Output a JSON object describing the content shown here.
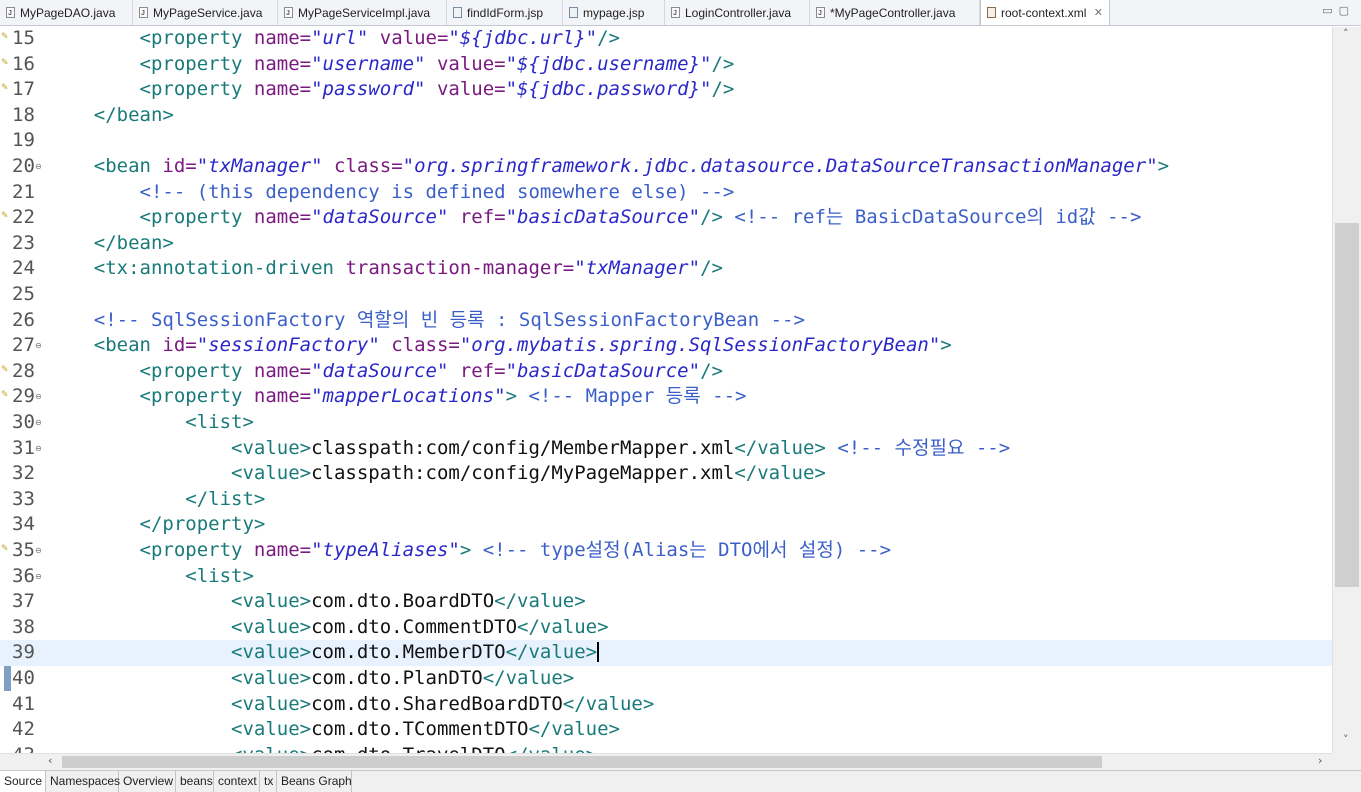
{
  "tabs": [
    {
      "label": "MyPageDAO.java",
      "icon": "java-file-icon",
      "kind": "java"
    },
    {
      "label": "MyPageService.java",
      "icon": "java-file-icon",
      "kind": "java"
    },
    {
      "label": "MyPageServiceImpl.java",
      "icon": "java-file-icon",
      "kind": "java"
    },
    {
      "label": "findIdForm.jsp",
      "icon": "jsp-file-icon",
      "kind": "jsp"
    },
    {
      "label": "mypage.jsp",
      "icon": "jsp-file-icon",
      "kind": "jsp"
    },
    {
      "label": "LoginController.java",
      "icon": "java-file-icon",
      "kind": "java"
    },
    {
      "label": "*MyPageController.java",
      "icon": "java-file-icon",
      "kind": "java"
    },
    {
      "label": "root-context.xml",
      "icon": "xml-file-icon",
      "kind": "xml",
      "active": true
    }
  ],
  "tab_close_glyph": "✕",
  "window_buttons": {
    "minimize": "▭",
    "maximize": "▢"
  },
  "editor": {
    "current_line": 39,
    "lines": [
      {
        "num": "15",
        "marker": true,
        "fold": false,
        "segs": [
          [
            "tx",
            "        "
          ],
          [
            "tag",
            "<property "
          ],
          [
            "an",
            "name="
          ],
          [
            "av",
            "\"url\""
          ],
          [
            "an",
            " value="
          ],
          [
            "av",
            "\"${jdbc.url}\""
          ],
          [
            "tag",
            "/>"
          ]
        ]
      },
      {
        "num": "16",
        "marker": true,
        "fold": false,
        "segs": [
          [
            "tx",
            "        "
          ],
          [
            "tag",
            "<property "
          ],
          [
            "an",
            "name="
          ],
          [
            "av",
            "\"username\""
          ],
          [
            "an",
            " value="
          ],
          [
            "av",
            "\"${jdbc.username}\""
          ],
          [
            "tag",
            "/>"
          ]
        ]
      },
      {
        "num": "17",
        "marker": true,
        "fold": false,
        "segs": [
          [
            "tx",
            "        "
          ],
          [
            "tag",
            "<property "
          ],
          [
            "an",
            "name="
          ],
          [
            "av",
            "\"password\""
          ],
          [
            "an",
            " value="
          ],
          [
            "av",
            "\"${jdbc.password}\""
          ],
          [
            "tag",
            "/>"
          ]
        ]
      },
      {
        "num": "18",
        "marker": false,
        "fold": false,
        "segs": [
          [
            "tx",
            "    "
          ],
          [
            "tag",
            "</bean>"
          ]
        ]
      },
      {
        "num": "19",
        "marker": false,
        "fold": false,
        "segs": []
      },
      {
        "num": "20",
        "marker": false,
        "fold": true,
        "segs": [
          [
            "tx",
            "    "
          ],
          [
            "tag",
            "<bean "
          ],
          [
            "an",
            "id="
          ],
          [
            "av",
            "\"txManager\""
          ],
          [
            "an",
            " class="
          ],
          [
            "av",
            "\"org.springframework.jdbc.datasource.DataSourceTransactionManager\""
          ],
          [
            "tag",
            ">"
          ]
        ]
      },
      {
        "num": "21",
        "marker": false,
        "fold": false,
        "segs": [
          [
            "tx",
            "        "
          ],
          [
            "cm",
            "<!-- (this dependency is defined somewhere else) -->"
          ]
        ]
      },
      {
        "num": "22",
        "marker": true,
        "fold": false,
        "segs": [
          [
            "tx",
            "        "
          ],
          [
            "tag",
            "<property "
          ],
          [
            "an",
            "name="
          ],
          [
            "av",
            "\"dataSource\""
          ],
          [
            "an",
            " ref="
          ],
          [
            "av",
            "\"basicDataSource\""
          ],
          [
            "tag",
            "/> "
          ],
          [
            "cm",
            "<!-- ref는 BasicDataSource의 id값 -->"
          ]
        ]
      },
      {
        "num": "23",
        "marker": false,
        "fold": false,
        "segs": [
          [
            "tx",
            "    "
          ],
          [
            "tag",
            "</bean>"
          ]
        ]
      },
      {
        "num": "24",
        "marker": false,
        "fold": false,
        "segs": [
          [
            "tx",
            "    "
          ],
          [
            "tag",
            "<tx:annotation-driven "
          ],
          [
            "an",
            "transaction-manager="
          ],
          [
            "av",
            "\"txManager\""
          ],
          [
            "tag",
            "/>"
          ]
        ]
      },
      {
        "num": "25",
        "marker": false,
        "fold": false,
        "segs": []
      },
      {
        "num": "26",
        "marker": false,
        "fold": false,
        "segs": [
          [
            "tx",
            "    "
          ],
          [
            "cm",
            "<!-- SqlSessionFactory 역할의 빈 등록 : SqlSessionFactoryBean -->"
          ]
        ]
      },
      {
        "num": "27",
        "marker": false,
        "fold": true,
        "segs": [
          [
            "tx",
            "    "
          ],
          [
            "tag",
            "<bean "
          ],
          [
            "an",
            "id="
          ],
          [
            "av",
            "\"sessionFactory\""
          ],
          [
            "an",
            " class="
          ],
          [
            "av",
            "\"org.mybatis.spring.SqlSessionFactoryBean\""
          ],
          [
            "tag",
            ">"
          ]
        ]
      },
      {
        "num": "28",
        "marker": true,
        "fold": false,
        "segs": [
          [
            "tx",
            "        "
          ],
          [
            "tag",
            "<property "
          ],
          [
            "an",
            "name="
          ],
          [
            "av",
            "\"dataSource\""
          ],
          [
            "an",
            " ref="
          ],
          [
            "av",
            "\"basicDataSource\""
          ],
          [
            "tag",
            "/>"
          ]
        ]
      },
      {
        "num": "29",
        "marker": true,
        "fold": true,
        "segs": [
          [
            "tx",
            "        "
          ],
          [
            "tag",
            "<property "
          ],
          [
            "an",
            "name="
          ],
          [
            "av",
            "\"mapperLocations\""
          ],
          [
            "tag",
            "> "
          ],
          [
            "cm",
            "<!-- Mapper 등록 -->"
          ]
        ]
      },
      {
        "num": "30",
        "marker": false,
        "fold": true,
        "segs": [
          [
            "tx",
            "            "
          ],
          [
            "tag",
            "<list>"
          ]
        ]
      },
      {
        "num": "31",
        "marker": false,
        "fold": true,
        "segs": [
          [
            "tx",
            "                "
          ],
          [
            "tag",
            "<value>"
          ],
          [
            "tx",
            "classpath:com/config/MemberMapper.xml"
          ],
          [
            "tag",
            "</value> "
          ],
          [
            "cm",
            "<!-- 수정필요 -->"
          ]
        ]
      },
      {
        "num": "32",
        "marker": false,
        "fold": false,
        "segs": [
          [
            "tx",
            "                "
          ],
          [
            "tag",
            "<value>"
          ],
          [
            "tx",
            "classpath:com/config/MyPageMapper.xml"
          ],
          [
            "tag",
            "</value>"
          ]
        ]
      },
      {
        "num": "33",
        "marker": false,
        "fold": false,
        "segs": [
          [
            "tx",
            "            "
          ],
          [
            "tag",
            "</list>"
          ]
        ]
      },
      {
        "num": "34",
        "marker": false,
        "fold": false,
        "segs": [
          [
            "tx",
            "        "
          ],
          [
            "tag",
            "</property>"
          ]
        ]
      },
      {
        "num": "35",
        "marker": true,
        "fold": true,
        "segs": [
          [
            "tx",
            "        "
          ],
          [
            "tag",
            "<property "
          ],
          [
            "an",
            "name="
          ],
          [
            "av",
            "\"typeAliases\""
          ],
          [
            "tag",
            "> "
          ],
          [
            "cm",
            "<!-- type설정(Alias는 DTO에서 설정) -->"
          ]
        ]
      },
      {
        "num": "36",
        "marker": false,
        "fold": true,
        "segs": [
          [
            "tx",
            "            "
          ],
          [
            "tag",
            "<list>"
          ]
        ]
      },
      {
        "num": "37",
        "marker": false,
        "fold": false,
        "segs": [
          [
            "tx",
            "                "
          ],
          [
            "tag",
            "<value>"
          ],
          [
            "tx",
            "com.dto.BoardDTO"
          ],
          [
            "tag",
            "</value>"
          ]
        ]
      },
      {
        "num": "38",
        "marker": false,
        "fold": false,
        "segs": [
          [
            "tx",
            "                "
          ],
          [
            "tag",
            "<value>"
          ],
          [
            "tx",
            "com.dto.CommentDTO"
          ],
          [
            "tag",
            "</value>"
          ]
        ]
      },
      {
        "num": "39",
        "marker": false,
        "fold": false,
        "caret": true,
        "segs": [
          [
            "tx",
            "                "
          ],
          [
            "tag",
            "<value>"
          ],
          [
            "tx",
            "com.dto.MemberDTO"
          ],
          [
            "tag",
            "</value>"
          ]
        ]
      },
      {
        "num": "40",
        "marker": false,
        "fold": false,
        "segs": [
          [
            "tx",
            "                "
          ],
          [
            "tag",
            "<value>"
          ],
          [
            "tx",
            "com.dto.PlanDTO"
          ],
          [
            "tag",
            "</value>"
          ]
        ]
      },
      {
        "num": "41",
        "marker": false,
        "fold": false,
        "segs": [
          [
            "tx",
            "                "
          ],
          [
            "tag",
            "<value>"
          ],
          [
            "tx",
            "com.dto.SharedBoardDTO"
          ],
          [
            "tag",
            "</value>"
          ]
        ]
      },
      {
        "num": "42",
        "marker": false,
        "fold": false,
        "segs": [
          [
            "tx",
            "                "
          ],
          [
            "tag",
            "<value>"
          ],
          [
            "tx",
            "com.dto.TCommentDTO"
          ],
          [
            "tag",
            "</value>"
          ]
        ]
      },
      {
        "num": "43",
        "marker": false,
        "fold": false,
        "segs": [
          [
            "tx",
            "                "
          ],
          [
            "tag",
            "<value>"
          ],
          [
            "tx",
            "com.dto.TravelDTO"
          ],
          [
            "tag",
            "</value>"
          ]
        ]
      }
    ],
    "marker_glyph": "✎",
    "fold_glyph": "⊖"
  },
  "scrollbars": {
    "vertical_position": 0.27,
    "horizontal_position": 0.04,
    "up_arrow": "˄",
    "down_arrow": "˅",
    "left_arrow": "‹",
    "right_arrow": "›"
  },
  "bottom_tabs": [
    {
      "label": "Source",
      "active": true
    },
    {
      "label": "Namespaces"
    },
    {
      "label": "Overview"
    },
    {
      "label": "beans"
    },
    {
      "label": "context"
    },
    {
      "label": "tx"
    },
    {
      "label": "Beans Graph"
    }
  ]
}
